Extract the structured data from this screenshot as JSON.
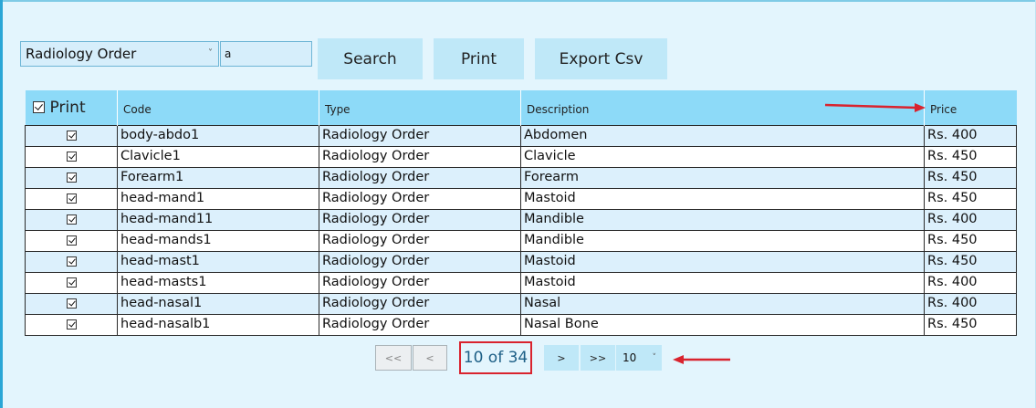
{
  "toolbar": {
    "order_type": "Radiology Order",
    "search_value": "a",
    "search_label": "Search",
    "print_label": "Print",
    "export_label": "Export Csv"
  },
  "table": {
    "headers": {
      "print": "Print",
      "code": "Code",
      "type": "Type",
      "description": "Description",
      "price": "Price"
    },
    "rows": [
      {
        "code": "body-abdo1",
        "type": "Radiology Order",
        "description": "Abdomen",
        "price": "Rs. 400"
      },
      {
        "code": "Clavicle1",
        "type": "Radiology Order",
        "description": "Clavicle",
        "price": "Rs. 450"
      },
      {
        "code": "Forearm1",
        "type": "Radiology Order",
        "description": "Forearm",
        "price": "Rs. 450"
      },
      {
        "code": "head-mand1",
        "type": "Radiology Order",
        "description": "Mastoid",
        "price": "Rs. 450"
      },
      {
        "code": "head-mand11",
        "type": "Radiology Order",
        "description": "Mandible",
        "price": "Rs. 400"
      },
      {
        "code": "head-mands1",
        "type": "Radiology Order",
        "description": "Mandible",
        "price": "Rs. 450"
      },
      {
        "code": "head-mast1",
        "type": "Radiology Order",
        "description": "Mastoid",
        "price": "Rs. 450"
      },
      {
        "code": "head-masts1",
        "type": "Radiology Order",
        "description": "Mastoid",
        "price": "Rs. 400"
      },
      {
        "code": "head-nasal1",
        "type": "Radiology Order",
        "description": "Nasal",
        "price": "Rs. 400"
      },
      {
        "code": "head-nasalb1",
        "type": "Radiology Order",
        "description": "Nasal Bone",
        "price": "Rs. 450"
      }
    ]
  },
  "pager": {
    "first_label": "<<",
    "prev_label": "<",
    "indicator": "10 of 34",
    "next_label": ">",
    "last_label": ">>",
    "page_size": "10"
  },
  "annotations": {
    "arrow_color": "#d9232e",
    "highlight_color": "#d9232e"
  }
}
